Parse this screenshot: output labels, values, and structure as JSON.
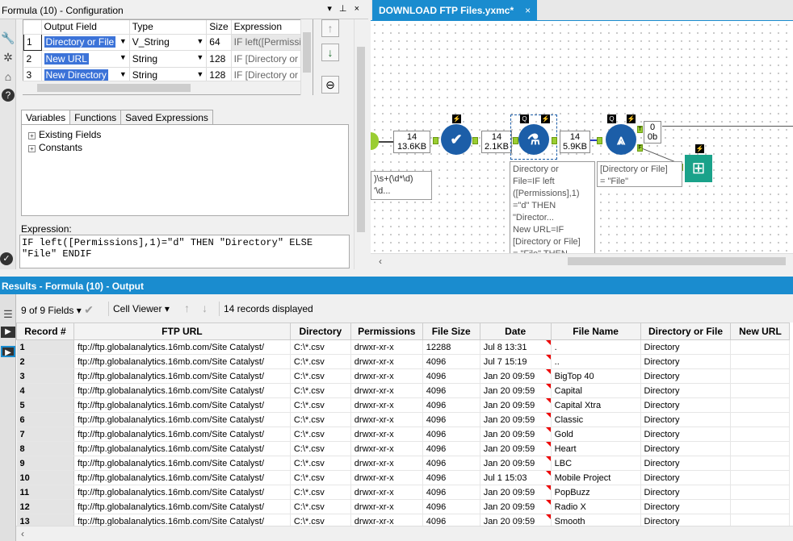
{
  "config": {
    "title": "Formula (10) - Configuration",
    "title_controls": "▾ ⊥ ×",
    "columns": [
      "Output Field",
      "Type",
      "Size",
      "Expression"
    ],
    "rows": [
      {
        "num": "1",
        "field": "Directory or File",
        "type": "V_String",
        "size": "64",
        "expr": "IF left([Permissi"
      },
      {
        "num": "2",
        "field": "New URL",
        "type": "String",
        "size": "128",
        "expr": "IF [Directory or"
      },
      {
        "num": "3",
        "field": "New Directory",
        "type": "String",
        "size": "128",
        "expr": "IF [Directory or"
      }
    ],
    "side_buttons": [
      "↑",
      "↓",
      "⊖"
    ],
    "tabs": [
      "Variables",
      "Functions",
      "Saved Expressions"
    ],
    "tree_items": [
      "Existing Fields",
      "Constants"
    ],
    "expression_label": "Expression:",
    "expression": "IF left([Permissions],1)=\"d\" THEN \"Directory\" ELSE\n\"File\" ENDIF"
  },
  "canvas": {
    "tab_title": "DOWNLOAD FTP Files.yxmc*",
    "tab_close": "×",
    "counts": [
      {
        "top": "14",
        "bottom": "13.6KB"
      },
      {
        "top": "14",
        "bottom": "2.1KB"
      },
      {
        "top": "14",
        "bottom": "5.9KB"
      },
      {
        "top": "0",
        "bottom": "0b"
      }
    ],
    "annotations": {
      "left": ")\\s+(\\d*\\d)\n'\\d...",
      "formula": "Directory or\nFile=IF left\n([Permissions],1)\n=\"d\" THEN\n\"Director...\nNew URL=IF\n[Directory or File]\n= \"File\" THEN",
      "filter": "[Directory or File]\n= \"File\""
    },
    "anchor_t": "T",
    "anchor_f": "F",
    "badge_q": "Q",
    "badge_bolt": "⚡"
  },
  "results": {
    "header": "Results - Formula (10) - Output",
    "fields_label": "9 of 9 Fields",
    "cell_viewer": "Cell Viewer",
    "records_displayed": "14 records displayed",
    "columns": [
      "Record #",
      "FTP URL",
      "Directory",
      "Permissions",
      "File Size",
      "Date",
      "File Name",
      "Directory or File",
      "New URL"
    ],
    "rows": [
      [
        "1",
        "ftp://ftp.globalanalytics.16mb.com/Site Catalyst/",
        "C:\\*.csv",
        "drwxr-xr-x",
        "12288",
        "Jul  8 13:31",
        ".",
        "Directory",
        ""
      ],
      [
        "2",
        "ftp://ftp.globalanalytics.16mb.com/Site Catalyst/",
        "C:\\*.csv",
        "drwxr-xr-x",
        "4096",
        "Jul  7 15:19",
        "..",
        "Directory",
        ""
      ],
      [
        "3",
        "ftp://ftp.globalanalytics.16mb.com/Site Catalyst/",
        "C:\\*.csv",
        "drwxr-xr-x",
        "4096",
        "Jan 20 09:59",
        "BigTop 40",
        "Directory",
        ""
      ],
      [
        "4",
        "ftp://ftp.globalanalytics.16mb.com/Site Catalyst/",
        "C:\\*.csv",
        "drwxr-xr-x",
        "4096",
        "Jan 20 09:59",
        "Capital",
        "Directory",
        ""
      ],
      [
        "5",
        "ftp://ftp.globalanalytics.16mb.com/Site Catalyst/",
        "C:\\*.csv",
        "drwxr-xr-x",
        "4096",
        "Jan 20 09:59",
        "Capital Xtra",
        "Directory",
        ""
      ],
      [
        "6",
        "ftp://ftp.globalanalytics.16mb.com/Site Catalyst/",
        "C:\\*.csv",
        "drwxr-xr-x",
        "4096",
        "Jan 20 09:59",
        "Classic",
        "Directory",
        ""
      ],
      [
        "7",
        "ftp://ftp.globalanalytics.16mb.com/Site Catalyst/",
        "C:\\*.csv",
        "drwxr-xr-x",
        "4096",
        "Jan 20 09:59",
        "Gold",
        "Directory",
        ""
      ],
      [
        "8",
        "ftp://ftp.globalanalytics.16mb.com/Site Catalyst/",
        "C:\\*.csv",
        "drwxr-xr-x",
        "4096",
        "Jan 20 09:59",
        "Heart",
        "Directory",
        ""
      ],
      [
        "9",
        "ftp://ftp.globalanalytics.16mb.com/Site Catalyst/",
        "C:\\*.csv",
        "drwxr-xr-x",
        "4096",
        "Jan 20 09:59",
        "LBC",
        "Directory",
        ""
      ],
      [
        "10",
        "ftp://ftp.globalanalytics.16mb.com/Site Catalyst/",
        "C:\\*.csv",
        "drwxr-xr-x",
        "4096",
        "Jul  1 15:03",
        "Mobile Project",
        "Directory",
        ""
      ],
      [
        "11",
        "ftp://ftp.globalanalytics.16mb.com/Site Catalyst/",
        "C:\\*.csv",
        "drwxr-xr-x",
        "4096",
        "Jan 20 09:59",
        "PopBuzz",
        "Directory",
        ""
      ],
      [
        "12",
        "ftp://ftp.globalanalytics.16mb.com/Site Catalyst/",
        "C:\\*.csv",
        "drwxr-xr-x",
        "4096",
        "Jan 20 09:59",
        "Radio X",
        "Directory",
        ""
      ],
      [
        "13",
        "ftp://ftp.globalanalytics.16mb.com/Site Catalyst/",
        "C:\\*.csv",
        "drwxr-xr-x",
        "4096",
        "Jan 20 09:59",
        "Smooth",
        "Directory",
        ""
      ]
    ]
  },
  "colors": {
    "accent": "#1a8ccf",
    "node": "#1c5ea8",
    "browse": "#1aa28a",
    "selection": "#3c73d8"
  }
}
